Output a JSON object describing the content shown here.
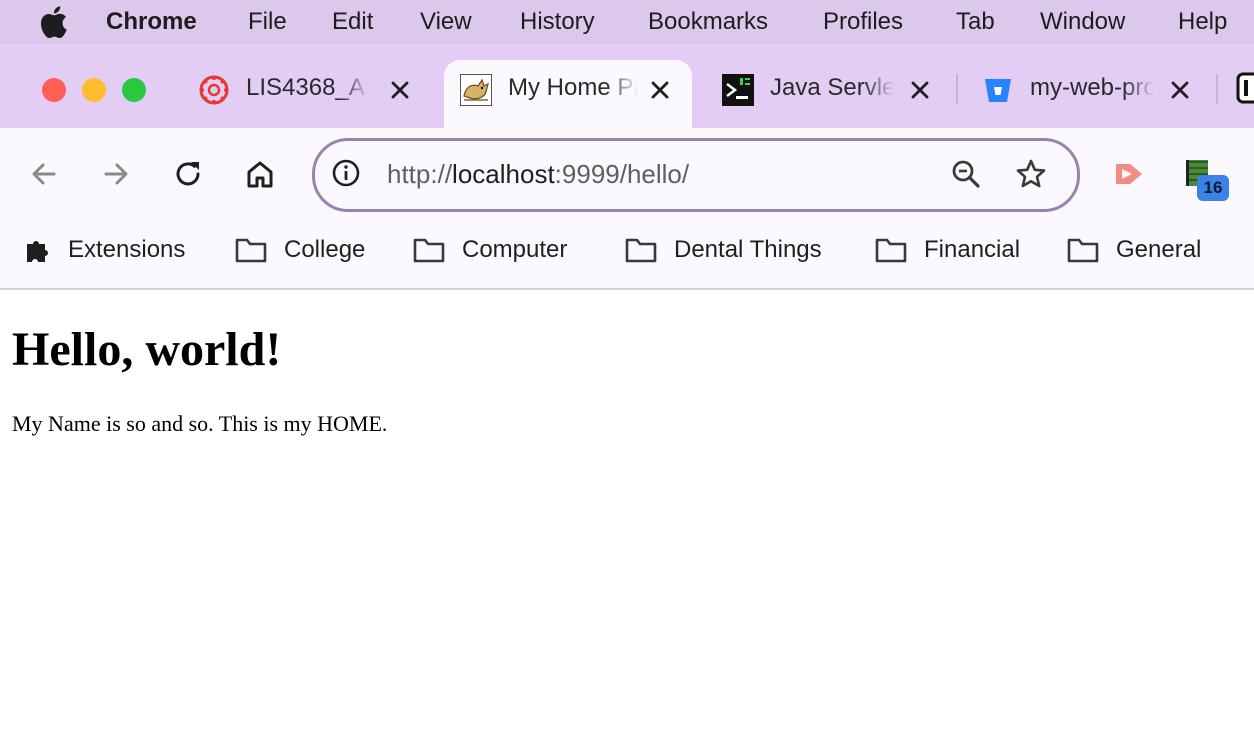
{
  "menubar": {
    "app_name": "Chrome",
    "items": [
      "File",
      "Edit",
      "View",
      "History",
      "Bookmarks",
      "Profiles",
      "Tab",
      "Window",
      "Help"
    ]
  },
  "tabs": [
    {
      "title": "LIS4368_A",
      "favicon": "canvas-lms-icon",
      "active": false
    },
    {
      "title": "My Home Page",
      "favicon": "tomcat-icon",
      "active": true
    },
    {
      "title": "Java Servlet",
      "favicon": "terminal-icon",
      "active": false
    },
    {
      "title": "my-web-project",
      "favicon": "bitbucket-icon",
      "active": false
    }
  ],
  "toolbar": {
    "url_scheme": "http://",
    "url_host": "localhost",
    "url_rest": ":9999/hello/",
    "extension_badge": "16"
  },
  "bookmarks": [
    {
      "label": "Extensions",
      "icon": "puzzle-icon"
    },
    {
      "label": "College",
      "icon": "folder-icon"
    },
    {
      "label": "Computer",
      "icon": "folder-icon"
    },
    {
      "label": "Dental Things",
      "icon": "folder-icon"
    },
    {
      "label": "Financial",
      "icon": "folder-icon"
    },
    {
      "label": "General",
      "icon": "folder-icon"
    }
  ],
  "page": {
    "heading": "Hello, world!",
    "paragraph": "My Name is so and so. This is my HOME."
  },
  "colors": {
    "menubar_bg": "#dcc8ea",
    "tabstrip_bg": "#e4cdf4",
    "toolbar_bg": "#fbf8fe",
    "omnibox_border": "#9a84ad",
    "traffic_close": "#fe5f57",
    "traffic_minimize": "#febc2e",
    "traffic_zoom": "#28c840"
  }
}
